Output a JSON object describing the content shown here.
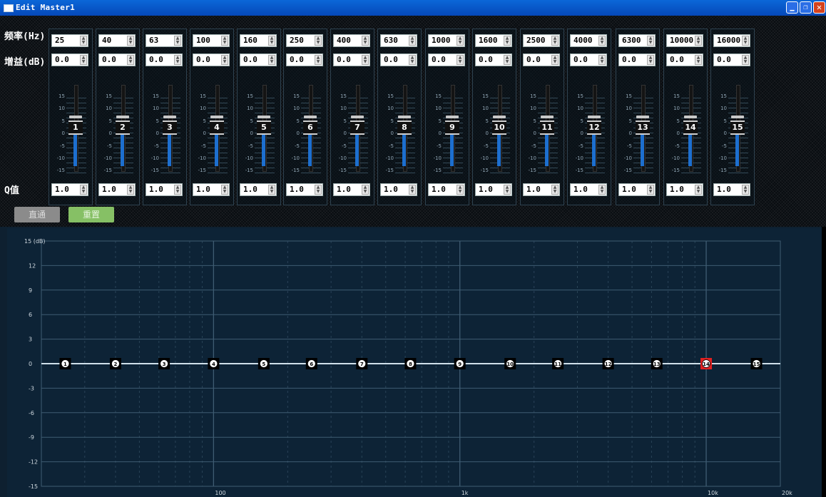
{
  "window": {
    "title": "Edit Master1"
  },
  "labels": {
    "freq": "频率(Hz)",
    "gain": "增益(dB)",
    "q": "Q值"
  },
  "bands": [
    {
      "num": "1",
      "freq": "25",
      "gain": "0.0",
      "q": "1.0"
    },
    {
      "num": "2",
      "freq": "40",
      "gain": "0.0",
      "q": "1.0"
    },
    {
      "num": "3",
      "freq": "63",
      "gain": "0.0",
      "q": "1.0"
    },
    {
      "num": "4",
      "freq": "100",
      "gain": "0.0",
      "q": "1.0"
    },
    {
      "num": "5",
      "freq": "160",
      "gain": "0.0",
      "q": "1.0"
    },
    {
      "num": "6",
      "freq": "250",
      "gain": "0.0",
      "q": "1.0"
    },
    {
      "num": "7",
      "freq": "400",
      "gain": "0.0",
      "q": "1.0"
    },
    {
      "num": "8",
      "freq": "630",
      "gain": "0.0",
      "q": "1.0"
    },
    {
      "num": "9",
      "freq": "1000",
      "gain": "0.0",
      "q": "1.0"
    },
    {
      "num": "10",
      "freq": "1600",
      "gain": "0.0",
      "q": "1.0"
    },
    {
      "num": "11",
      "freq": "2500",
      "gain": "0.0",
      "q": "1.0"
    },
    {
      "num": "12",
      "freq": "4000",
      "gain": "0.0",
      "q": "1.0"
    },
    {
      "num": "13",
      "freq": "6300",
      "gain": "0.0",
      "q": "1.0"
    },
    {
      "num": "14",
      "freq": "10000",
      "gain": "0.0",
      "q": "1.0"
    },
    {
      "num": "15",
      "freq": "16000",
      "gain": "0.0",
      "q": "1.0"
    }
  ],
  "slider_scale": [
    "15",
    "10",
    "5",
    "0",
    "-5",
    "-10",
    "-15"
  ],
  "buttons": {
    "bypass": "直通",
    "reset": "重置"
  },
  "chart_data": {
    "type": "line",
    "y_unit_label": "15 (dB)",
    "y_ticks": [
      "12",
      "9",
      "6",
      "3",
      "0",
      "-3",
      "-6",
      "-9",
      "-12",
      "-15"
    ],
    "ylim": [
      -15,
      15
    ],
    "x_scale": "log",
    "xlim": [
      20,
      20000
    ],
    "x_tick_labels": [
      "100",
      "1k",
      "10k",
      "20k"
    ],
    "grid": true,
    "series": [
      {
        "x": [
          25,
          40,
          63,
          100,
          160,
          250,
          400,
          630,
          1000,
          1600,
          2500,
          4000,
          6300,
          10000,
          16000
        ],
        "y": [
          0,
          0,
          0,
          0,
          0,
          0,
          0,
          0,
          0,
          0,
          0,
          0,
          0,
          0,
          0
        ]
      }
    ],
    "points": [
      {
        "label": "1",
        "x": 25,
        "y": 0
      },
      {
        "label": "2",
        "x": 40,
        "y": 0
      },
      {
        "label": "3",
        "x": 63,
        "y": 0
      },
      {
        "label": "4",
        "x": 100,
        "y": 0
      },
      {
        "label": "5",
        "x": 160,
        "y": 0
      },
      {
        "label": "6",
        "x": 250,
        "y": 0
      },
      {
        "label": "7",
        "x": 400,
        "y": 0
      },
      {
        "label": "8",
        "x": 630,
        "y": 0
      },
      {
        "label": "9",
        "x": 1000,
        "y": 0
      },
      {
        "label": "10",
        "x": 1600,
        "y": 0
      },
      {
        "label": "11",
        "x": 2500,
        "y": 0
      },
      {
        "label": "12",
        "x": 4000,
        "y": 0
      },
      {
        "label": "13",
        "x": 6300,
        "y": 0
      },
      {
        "label": "14",
        "x": 10000,
        "y": 0,
        "selected": true
      },
      {
        "label": "15",
        "x": 16000,
        "y": 0
      }
    ],
    "colors": {
      "background": "#0d2336",
      "grid": "#3f5c72",
      "curve": "#cfe0ea",
      "selected": "#e02020"
    }
  }
}
